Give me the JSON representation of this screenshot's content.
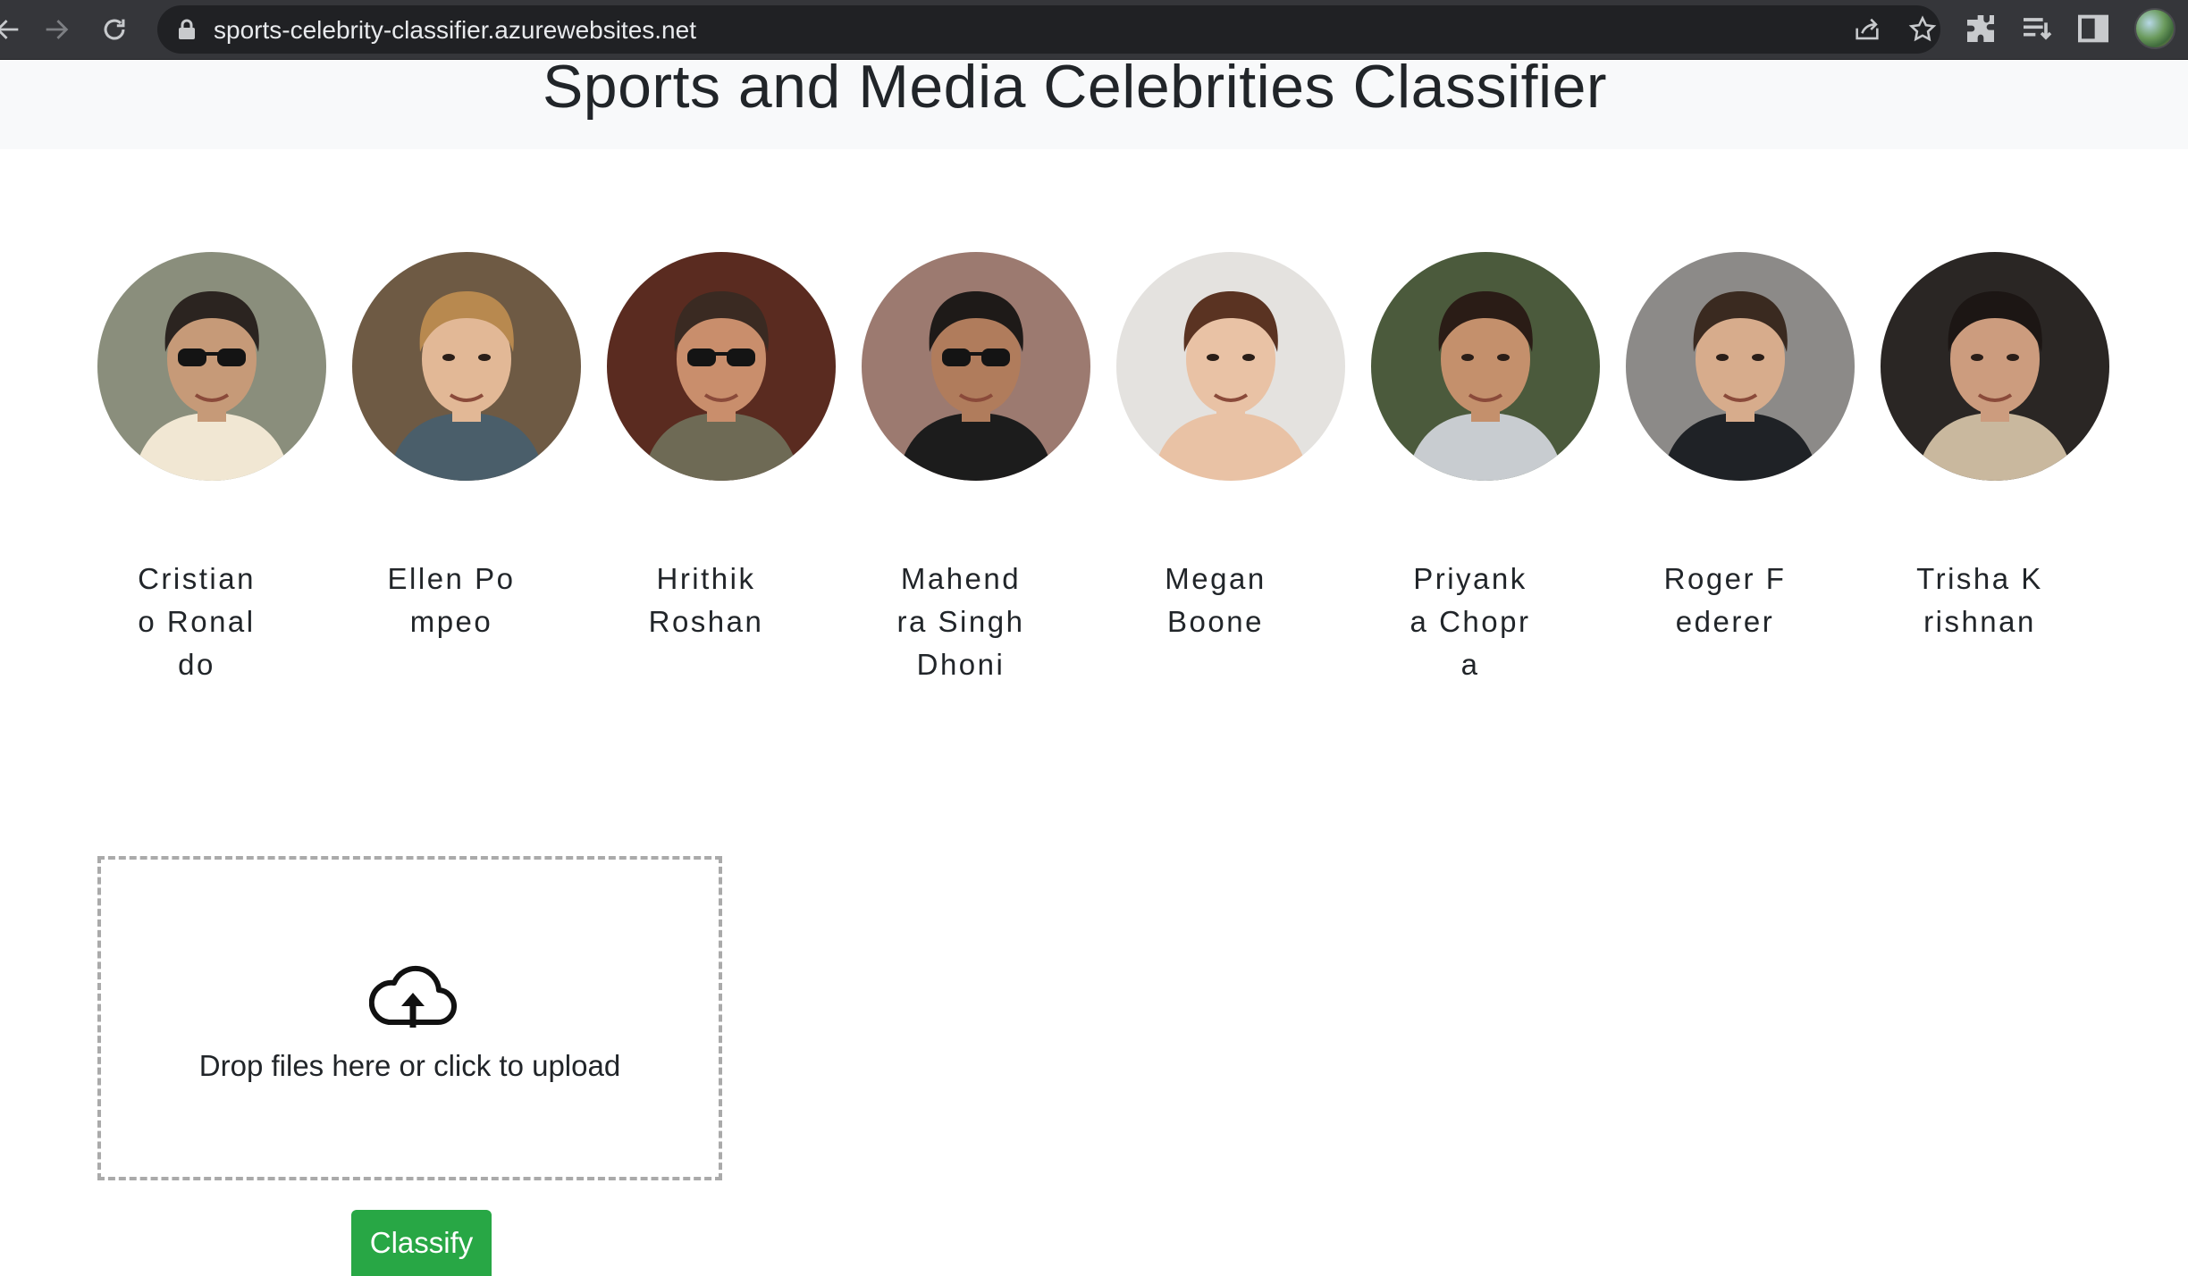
{
  "browser": {
    "url": "sports-celebrity-classifier.azurewebsites.net",
    "icons": [
      "back-icon",
      "forward-icon",
      "reload-icon",
      "lock-icon",
      "share-icon",
      "bookmark-star-icon",
      "extensions-icon",
      "reading-list-icon",
      "side-panel-icon",
      "profile-avatar"
    ]
  },
  "page": {
    "title": "Sports and Media Celebrities Classifier"
  },
  "celebrities": [
    {
      "name": "Cristiano Ronaldo",
      "bg": "#8a8e7c",
      "skin": "#c69a78",
      "hair": "#2b2420",
      "shirt": "#f1e7d3",
      "glasses": true
    },
    {
      "name": "Ellen Pompeo",
      "bg": "#6e5a44",
      "skin": "#e2b896",
      "hair": "#b8894f",
      "shirt": "#4a5e6a",
      "glasses": false
    },
    {
      "name": "Hrithik Roshan",
      "bg": "#5a2b20",
      "skin": "#c98e6c",
      "hair": "#3a2a22",
      "shirt": "#6e6a55",
      "glasses": true
    },
    {
      "name": "Mahendra Singh Dhoni",
      "bg": "#9c7a70",
      "skin": "#b07c5c",
      "hair": "#1e1a18",
      "shirt": "#1c1c1c",
      "glasses": true
    },
    {
      "name": "Megan Boone",
      "bg": "#e4e2df",
      "skin": "#e9c2a5",
      "hair": "#5a3322",
      "shirt": "#e9c2a5",
      "glasses": false
    },
    {
      "name": "Priyanka Chopra",
      "bg": "#4b5a3c",
      "skin": "#c4906c",
      "hair": "#2a1c16",
      "shirt": "#c8ccd0",
      "glasses": false
    },
    {
      "name": "Roger Federer",
      "bg": "#8c8a88",
      "skin": "#d7ac8c",
      "hair": "#3a2a20",
      "shirt": "#1f2226",
      "glasses": false
    },
    {
      "name": "Trisha Krishnan",
      "bg": "#2a2624",
      "skin": "#cc9c7e",
      "hair": "#1c1614",
      "shirt": "#c9b89e",
      "glasses": false
    }
  ],
  "dropzone": {
    "text": "Drop files here or click to upload",
    "icon": "cloud-upload-icon"
  },
  "classify_button": {
    "label": "Classify",
    "color": "#28a745"
  }
}
